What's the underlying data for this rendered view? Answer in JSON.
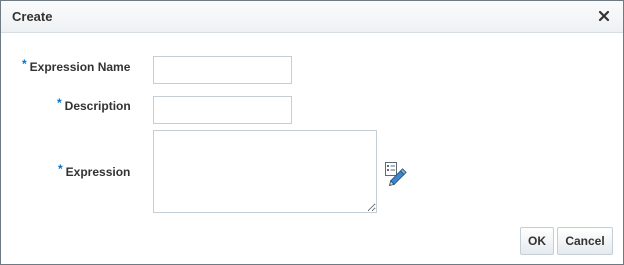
{
  "dialog": {
    "title": "Create",
    "close_icon": "close-icon"
  },
  "form": {
    "required_marker": "*",
    "expression_name": {
      "label": "Expression Name",
      "value": ""
    },
    "description": {
      "label": "Description",
      "value": ""
    },
    "expression": {
      "label": "Expression",
      "value": "",
      "tool_icon": "expression-builder-icon"
    }
  },
  "buttons": {
    "ok_label": "OK",
    "cancel_label": "Cancel"
  },
  "colors": {
    "required_marker": "#0572ce",
    "border": "#c4ced7"
  }
}
